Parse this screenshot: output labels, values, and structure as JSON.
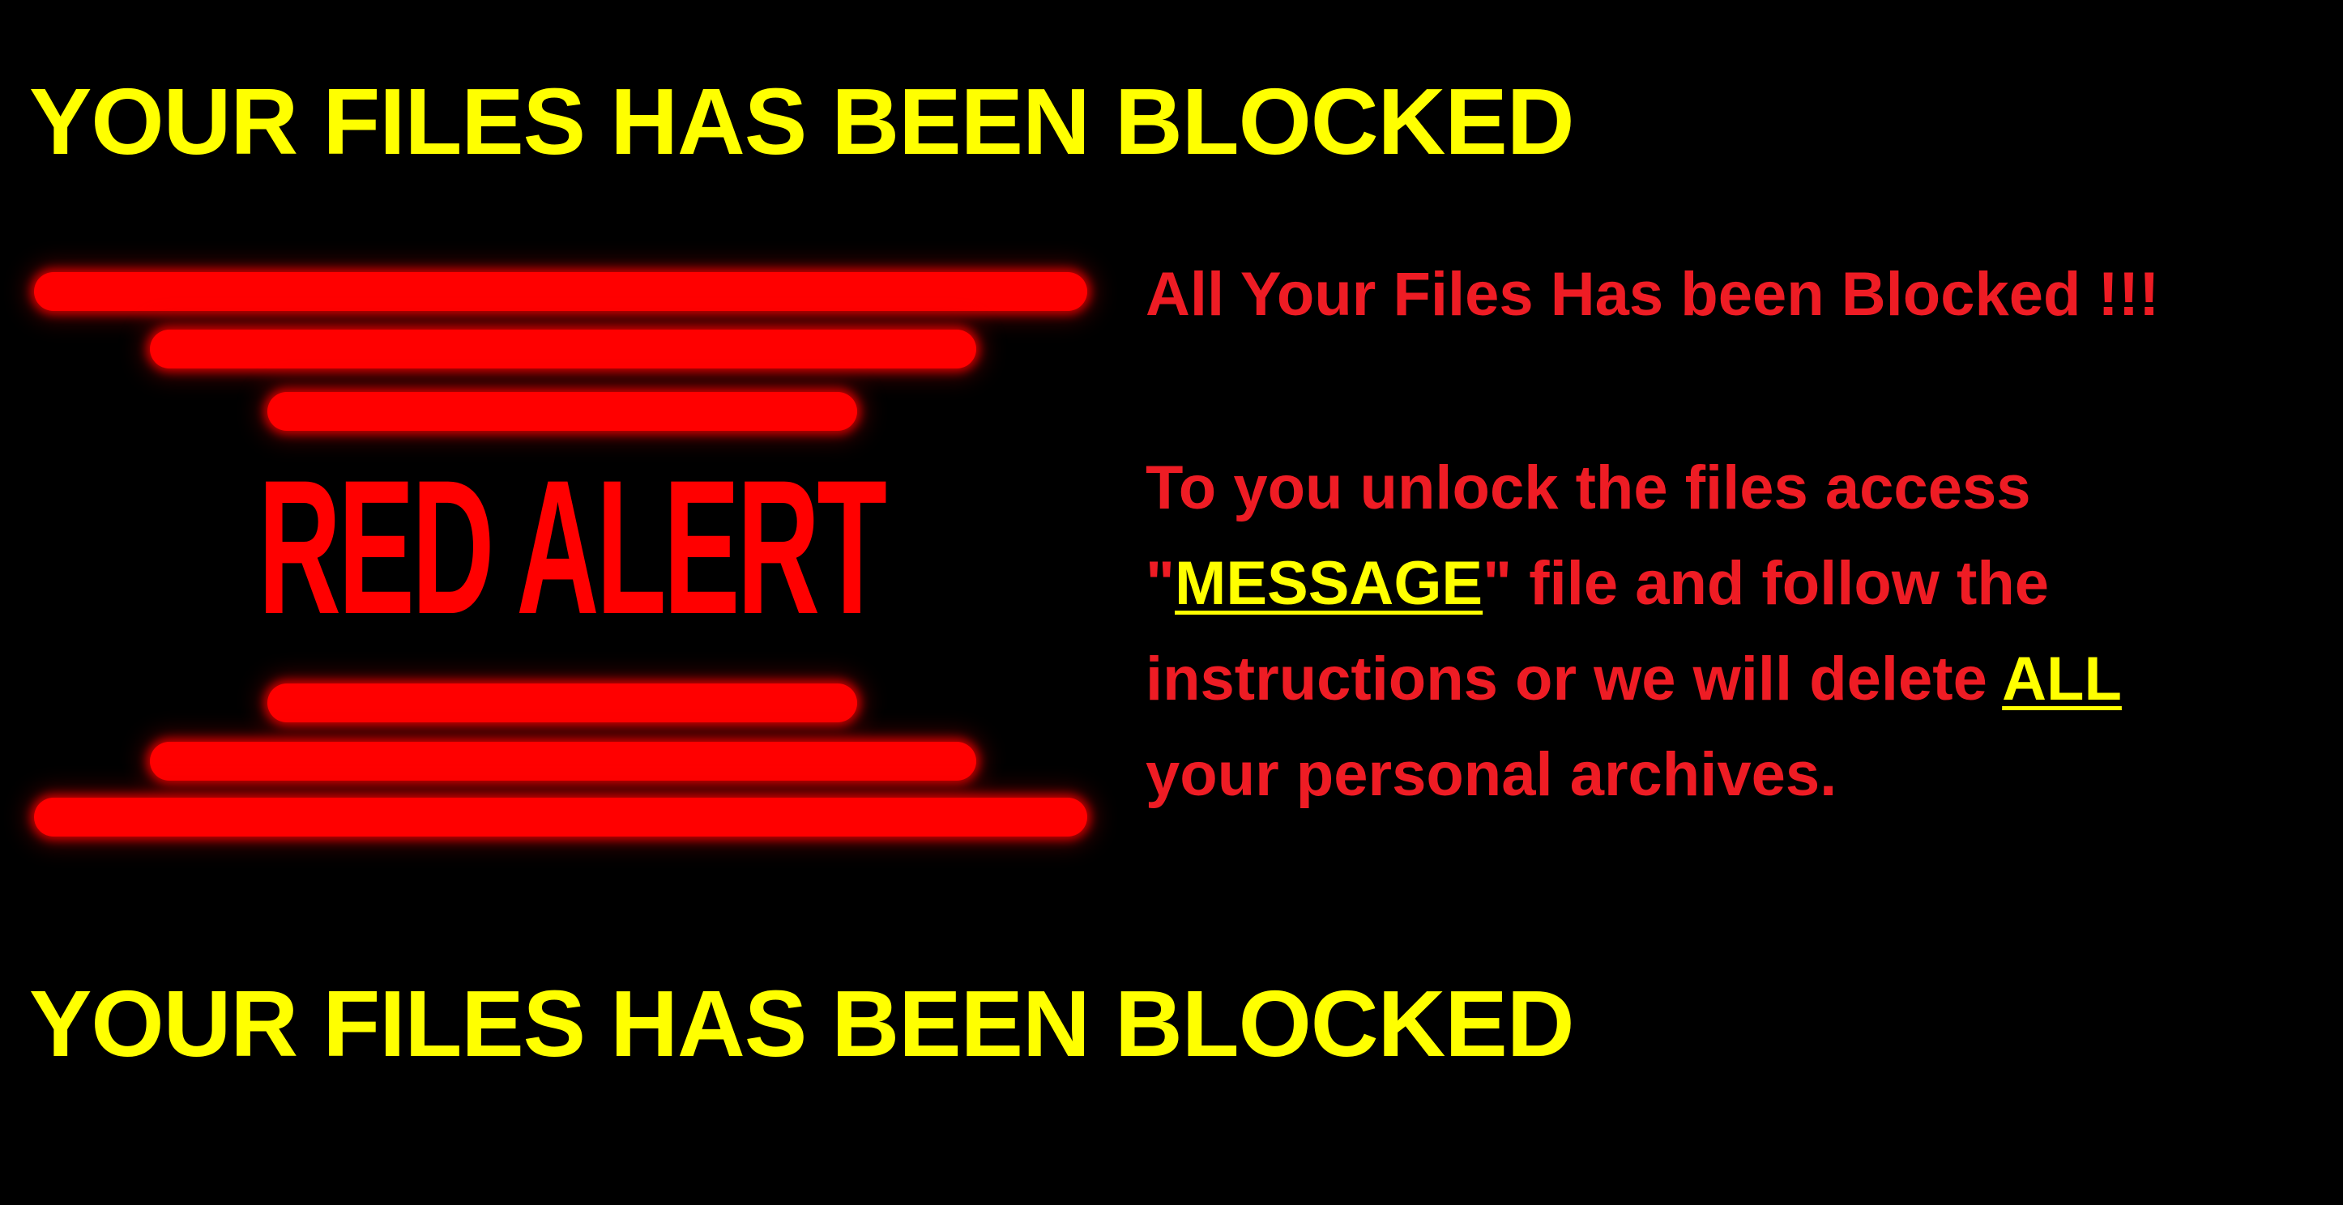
{
  "banner": {
    "top": "YOUR FILES HAS BEEN BLOCKED",
    "bottom": "YOUR FILES HAS BEEN BLOCKED"
  },
  "alert_graphic": {
    "text": "RED ALERT",
    "icon": "red-alert-logo"
  },
  "message": {
    "headline": "All Your Files Has been Blocked !!!",
    "line1": "To you unlock the files access",
    "line2_quote_open": "\"",
    "line2_keyword": "MESSAGE",
    "line2_rest": "\" file and follow the",
    "line3_prefix": "instructions or we will delete ",
    "line3_keyword": "ALL",
    "line4": "your personal archives."
  },
  "colors": {
    "background": "#000000",
    "banner": "#ffff00",
    "alert": "#ff0000",
    "message": "#ee1c24",
    "highlight": "#ffff00"
  }
}
